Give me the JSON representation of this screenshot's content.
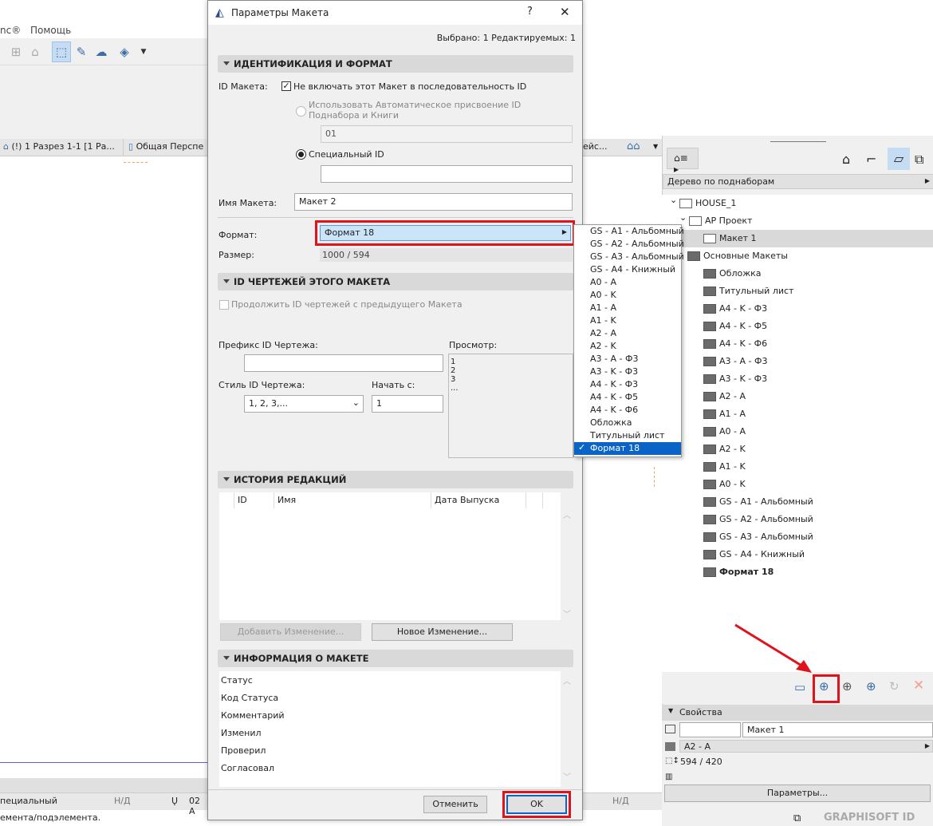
{
  "app": {
    "menu": [
      "nc®",
      "Помощь"
    ],
    "view_tabs": [
      "(!) 1 Разрез 1-1 [1 Ра...",
      "Общая Перспе",
      "ейс..."
    ],
    "status_bar": {
      "left_text": "пециальный",
      "nd1": "Н/Д",
      "layer": "02 А",
      "nd2": "Н/Д",
      "hint": "емента/подэлемента."
    }
  },
  "dialog": {
    "title": "Параметры Макета",
    "help": "?",
    "close": "✕",
    "selection_info": "Выбрано: 1 Редактируемых: 1",
    "sections": {
      "id_format": {
        "header": "ИДЕНТИФИКАЦИЯ И ФОРМАТ",
        "id_label": "ID Макета:",
        "exclude_checkbox": "Не включать этот Макет в последовательность ID",
        "exclude_checked": true,
        "auto_radio": "Использовать Автоматическое присвоение ID Поднабора и Книги",
        "auto_value": "01",
        "custom_radio": "Специальный ID",
        "custom_value": "",
        "name_label": "Имя Макета:",
        "name_value": "Макет 2",
        "format_label": "Формат:",
        "format_value": "Формат 18",
        "size_label": "Размер:",
        "size_value": "1000 / 594"
      },
      "drawing_ids": {
        "header": "ID ЧЕРТЕЖЕЙ ЭТОГО МАКЕТА",
        "continue_checkbox": "Продолжить ID чертежей с предыдущего Макета",
        "prefix_label": "Префикс ID Чертежа:",
        "prefix_value": "",
        "style_label": "Стиль ID Чертежа:",
        "style_value": "1, 2, 3,...",
        "start_label": "Начать с:",
        "start_value": "1",
        "preview_label": "Просмотр:",
        "preview_lines": [
          "1",
          "2",
          "3",
          "..."
        ]
      },
      "history": {
        "header": "ИСТОРИЯ РЕДАКЦИЙ",
        "columns": [
          "ID",
          "Имя",
          "Дата Выпуска"
        ],
        "add_change": "Добавить Изменение...",
        "new_change": "Новое Изменение..."
      },
      "info": {
        "header": "ИНФОРМАЦИЯ О МАКЕТЕ",
        "rows": [
          "Статус",
          "Код Статуса",
          "Комментарий",
          "Изменил",
          "Проверил",
          "Согласовал"
        ]
      }
    },
    "cancel": "Отменить",
    "ok": "OK"
  },
  "format_dropdown": {
    "options": [
      "GS - A1 - Альбомный",
      "GS - A2 - Альбомный",
      "GS - A3 - Альбомный",
      "GS - A4 - Книжный",
      "A0 - A",
      "A0 - K",
      "A1 - A",
      "A1 - K",
      "A2 - A",
      "A2 - K",
      "A3 - A - Ф3",
      "A3 - K - Ф3",
      "A4 - K - Ф3",
      "A4 - K - Ф5",
      "A4 - K - Ф6",
      "Обложка",
      "Титульный лист",
      "Формат 18"
    ],
    "selected": "Формат 18",
    "selected_color": "#0a64c8"
  },
  "navigator": {
    "view_mode": "Дерево по поднаборам",
    "tree": [
      {
        "label": "HOUSE_1",
        "level": 0,
        "type": "book"
      },
      {
        "label": "АР Проект",
        "level": 1,
        "type": "subset"
      },
      {
        "label": "Макет 1",
        "level": 2,
        "type": "layout",
        "selected": true
      },
      {
        "label": "Основные Макеты",
        "level": 1,
        "type": "folder"
      },
      {
        "label": "Обложка",
        "level": 2,
        "type": "master"
      },
      {
        "label": "Титульный лист",
        "level": 2,
        "type": "master"
      },
      {
        "label": "A4 - K - Ф3",
        "level": 2,
        "type": "master"
      },
      {
        "label": "A4 - K - Ф5",
        "level": 2,
        "type": "master"
      },
      {
        "label": "A4 - K - Ф6",
        "level": 2,
        "type": "master"
      },
      {
        "label": "A3 - A - Ф3",
        "level": 2,
        "type": "master"
      },
      {
        "label": "A3 - K - Ф3",
        "level": 2,
        "type": "master"
      },
      {
        "label": "A2 - A",
        "level": 2,
        "type": "master"
      },
      {
        "label": "A1 - A",
        "level": 2,
        "type": "master"
      },
      {
        "label": "A0 - A",
        "level": 2,
        "type": "master"
      },
      {
        "label": "A2 - K",
        "level": 2,
        "type": "master"
      },
      {
        "label": "A1 - K",
        "level": 2,
        "type": "master"
      },
      {
        "label": "A0 - K",
        "level": 2,
        "type": "master"
      },
      {
        "label": "GS - A1 - Альбомный",
        "level": 2,
        "type": "master"
      },
      {
        "label": "GS - A2 - Альбомный",
        "level": 2,
        "type": "master"
      },
      {
        "label": "GS - A3 - Альбомный",
        "level": 2,
        "type": "master"
      },
      {
        "label": "GS - A4 - Книжный",
        "level": 2,
        "type": "master"
      },
      {
        "label": "Формат 18",
        "level": 2,
        "type": "master",
        "bold": true
      }
    ],
    "properties": {
      "header": "Свойства",
      "id_value": "",
      "name_value": "Макет 1",
      "master_value": "A2 - A",
      "size_value": "594 / 420",
      "settings_button": "Параметры..."
    },
    "brand": "GRAPHISOFT ID"
  },
  "highlight_color": "#e0121b"
}
